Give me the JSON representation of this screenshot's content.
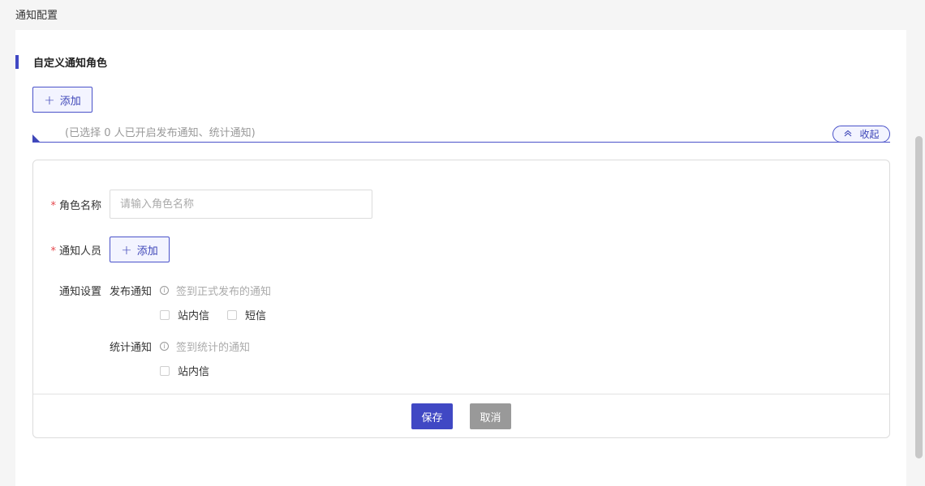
{
  "page": {
    "title": "通知配置"
  },
  "section": {
    "title": "自定义通知角色",
    "add_label": "添加",
    "summary": "(已选择 0 人已开启发布通知、统计通知)",
    "collapse_label": "收起"
  },
  "form": {
    "role_name": {
      "label": "角色名称",
      "placeholder": "请输入角色名称",
      "value": ""
    },
    "recipients": {
      "label": "通知人员",
      "add_label": "添加"
    },
    "settings": {
      "label": "通知设置",
      "publish": {
        "title": "发布通知",
        "hint": "签到正式发布的通知",
        "options": [
          "站内信",
          "短信"
        ]
      },
      "stats": {
        "title": "统计通知",
        "hint": "签到统计的通知",
        "options": [
          "站内信"
        ]
      }
    },
    "save_label": "保存",
    "cancel_label": "取消"
  },
  "colors": {
    "accent": "#4048c4",
    "required": "#e5484d",
    "cancel": "#999999"
  },
  "icons": {
    "plus": "plus-icon",
    "collapse": "chevron-up-double-icon",
    "info": "info-circle-icon"
  }
}
